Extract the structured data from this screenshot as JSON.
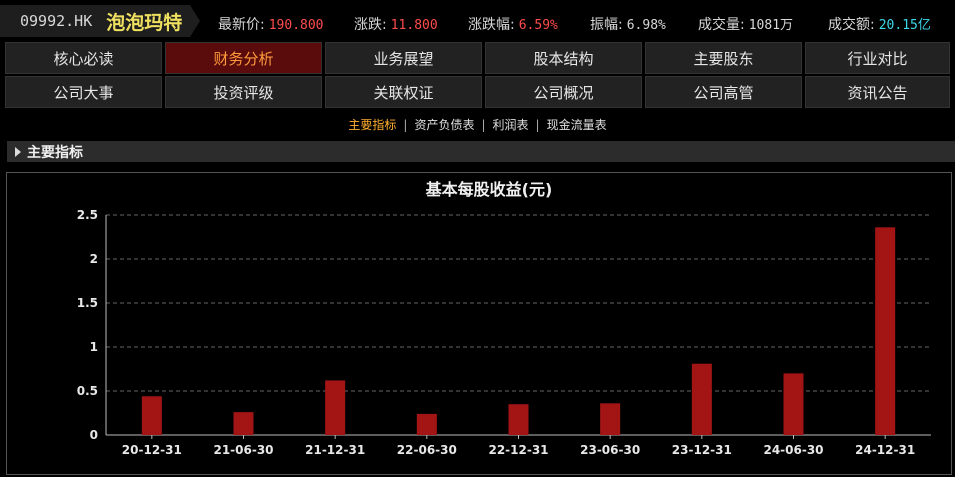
{
  "quote": {
    "code": "09992.HK",
    "name": "泡泡玛特",
    "price_label": "最新价:",
    "price": "190.800",
    "change_label": "涨跌:",
    "change": "11.800",
    "change_pct_label": "涨跌幅:",
    "change_pct": "6.59%",
    "amplitude_label": "振幅:",
    "amplitude": "6.98%",
    "volume_label": "成交量:",
    "volume": "1081万",
    "turnover_label": "成交额:",
    "turnover": "20.15亿"
  },
  "nav": {
    "row1": [
      "核心必读",
      "财务分析",
      "业务展望",
      "股本结构",
      "主要股东",
      "行业对比"
    ],
    "row2": [
      "公司大事",
      "投资评级",
      "关联权证",
      "公司概况",
      "公司高管",
      "资讯公告"
    ],
    "active": "财务分析"
  },
  "subtabs": {
    "items": [
      "主要指标",
      "资产负债表",
      "利润表",
      "现金流量表"
    ],
    "active": "主要指标"
  },
  "section": {
    "title": "主要指标"
  },
  "colors": {
    "bar": "#a31515",
    "active_nav_bg": "#5a0c0c",
    "active_text": "#ff9a3c"
  },
  "chart_data": {
    "type": "bar",
    "title": "基本每股收益(元)",
    "categories": [
      "20-12-31",
      "21-06-30",
      "21-12-31",
      "22-06-30",
      "22-12-31",
      "23-06-30",
      "23-12-31",
      "24-06-30",
      "24-12-31"
    ],
    "values": [
      0.44,
      0.26,
      0.62,
      0.24,
      0.35,
      0.36,
      0.81,
      0.7,
      2.36
    ],
    "ylim": [
      0,
      2.5
    ],
    "yticks": [
      "0",
      "0.5",
      "1",
      "1.5",
      "2",
      "2.5"
    ],
    "grid": true
  }
}
